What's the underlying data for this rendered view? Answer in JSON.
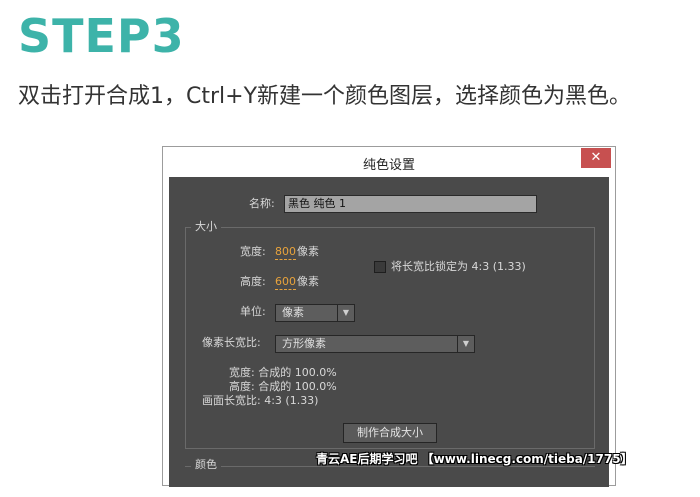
{
  "header": {
    "step": "STEP3",
    "instruction": "双击打开合成1，Ctrl+Y新建一个颜色图层，选择颜色为黑色。"
  },
  "dialog": {
    "title": "纯色设置",
    "close_glyph": "✕",
    "name_label": "名称:",
    "name_value": "黑色 纯色 1",
    "size_group": {
      "title": "大小",
      "width_label": "宽度:",
      "width_value": "800",
      "height_label": "高度:",
      "height_value": "600",
      "px_unit": "像素",
      "lock_label": "将长宽比锁定为 4:3 (1.33)",
      "lock_checked": false,
      "unit_label": "单位:",
      "unit_value": "像素",
      "pixel_aspect_label": "像素长宽比:",
      "pixel_aspect_value": "方形像素",
      "info_width": "宽度: 合成的  100.0%",
      "info_height": "高度: 合成的  100.0%",
      "info_frame": "画面长宽比: 4:3 (1.33)",
      "make_comp_size_button": "制作合成大小"
    },
    "color_group": {
      "title": "颜色"
    }
  },
  "watermark": "青云AE后期学习吧 【www.linecg.com/tieba/1775】",
  "colors": {
    "accent": "#3db3a9",
    "orange_value": "#e8a33c",
    "panel_bg": "#4a4a4a",
    "close_red": "#c75050"
  }
}
